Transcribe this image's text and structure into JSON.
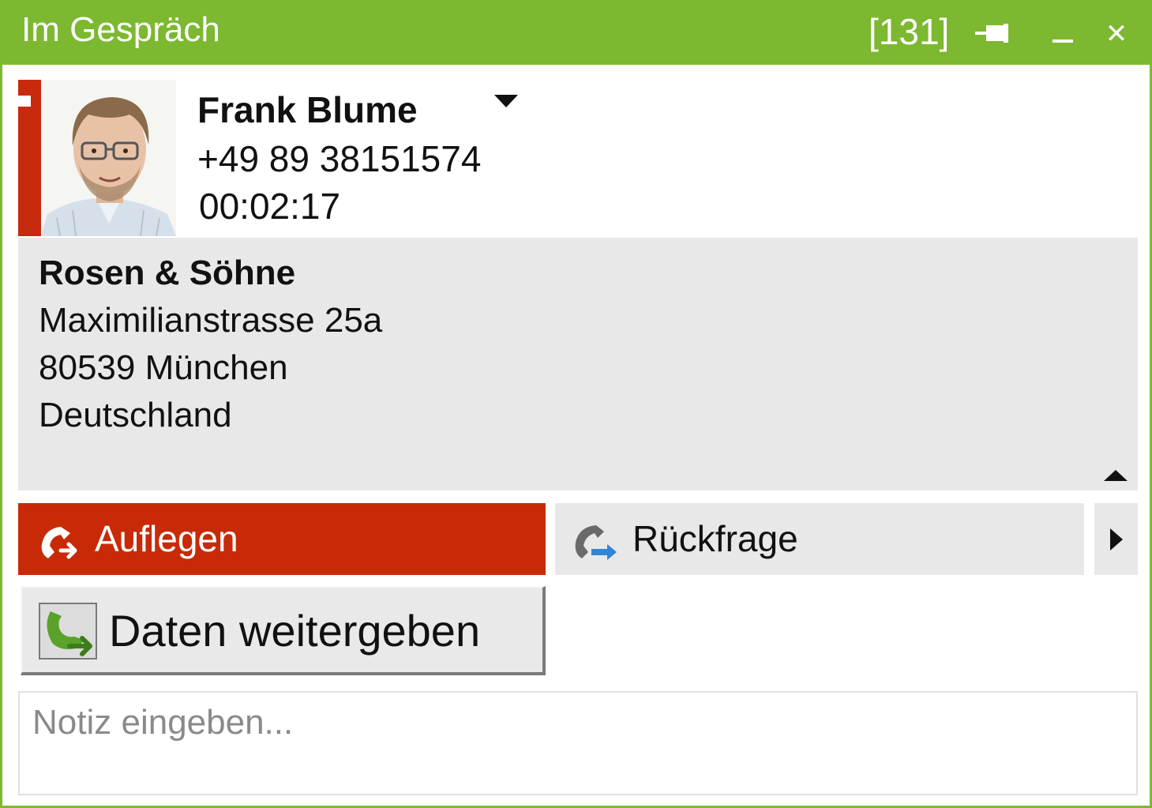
{
  "window": {
    "title": "Im Gespräch",
    "extension": "[131]",
    "accent_color": "#7cb830"
  },
  "caller": {
    "name": "Frank Blume",
    "phone": "+49 89 38151574",
    "duration": "00:02:17",
    "status_color": "#c82a10"
  },
  "company": {
    "name": "Rosen & Söhne",
    "street": "Maximilianstrasse 25a",
    "city": "80539 München",
    "country": "Deutschland"
  },
  "actions": {
    "hangup_label": "Auflegen",
    "hangup_color": "#c82a08",
    "consult_label": "Rückfrage",
    "share_label": "Daten weitergeben"
  },
  "note": {
    "placeholder": "Notiz eingeben...",
    "value": ""
  },
  "icons": {
    "pin": "pin-icon",
    "minimize": "minimize-icon",
    "close": "close-icon",
    "dropdown": "chevron-down-icon",
    "collapse": "chevron-up-icon",
    "hangup": "phone-hangup-icon",
    "consult": "phone-forward-icon",
    "more": "chevron-right-icon",
    "share": "share-data-icon"
  }
}
